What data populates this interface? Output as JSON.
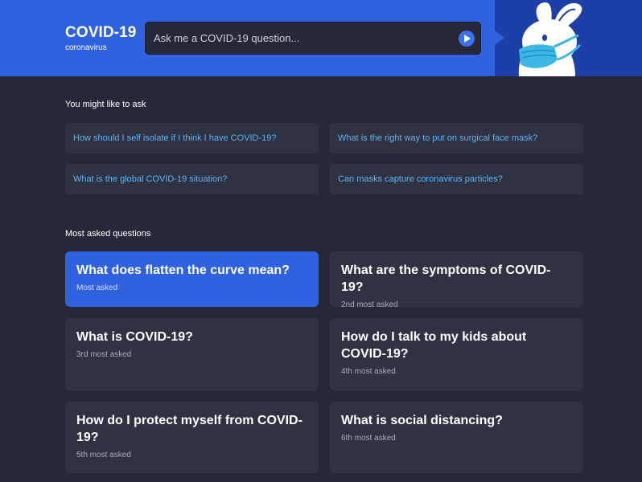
{
  "brand": {
    "title": "COVID-19",
    "subtitle": "coronavirus"
  },
  "search": {
    "placeholder": "Ask me a COVID-19 question...",
    "send_icon": "send-play-icon"
  },
  "mascot": {
    "icon": "bunny-with-face-mask-icon"
  },
  "suggestions": {
    "title": "You might like to ask",
    "items": [
      "How should I self isolate if I think I have COVID-19?",
      "What is the right way to put on surgical face mask?",
      "What is the global COVID-19 situation?",
      "Can masks capture coronavirus particles?"
    ]
  },
  "most_asked": {
    "title": "Most asked questions",
    "items": [
      {
        "question": "What does flatten the curve mean?",
        "rank": "Most asked",
        "active": true
      },
      {
        "question": "What are the symptoms of COVID-19?",
        "rank": "2nd most asked"
      },
      {
        "question": "What is COVID-19?",
        "rank": "3rd most asked"
      },
      {
        "question": "How do I talk to my kids about COVID-19?",
        "rank": "4th most asked"
      },
      {
        "question": "How do I protect myself from COVID-19?",
        "rank": "5th most asked"
      },
      {
        "question": "What is social distancing?",
        "rank": "6th most asked"
      }
    ]
  },
  "colors": {
    "background": "#252836",
    "header": "#3062e0",
    "mascot_panel": "#1d3fa8",
    "card": "#2e3242",
    "link": "#5eb4f6",
    "accent": "#3062e0"
  }
}
